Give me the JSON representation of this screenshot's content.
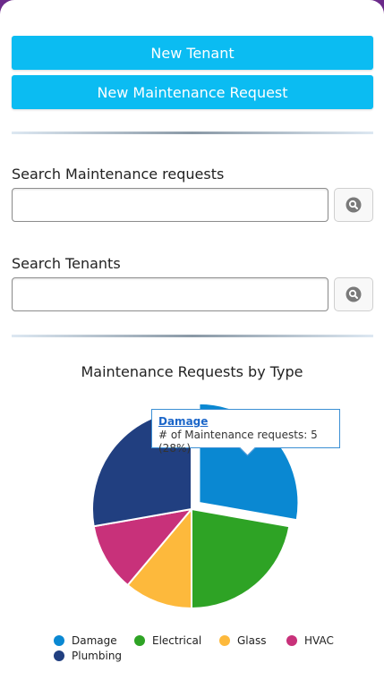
{
  "buttons": {
    "new_tenant": "New Tenant",
    "new_maintenance_request": "New Maintenance Request"
  },
  "search_maintenance": {
    "label": "Search Maintenance requests",
    "value": "",
    "button_icon": "search-icon"
  },
  "search_tenants": {
    "label": "Search Tenants",
    "value": "",
    "button_icon": "search-icon"
  },
  "tooltip": {
    "title": "Damage",
    "text": "# of Maintenance requests: 5 (28%)"
  },
  "colors": {
    "button": "#0bbcf2",
    "Damage": "#0a88d2",
    "Electrical": "#2ea325",
    "Glass": "#fdb93c",
    "HVAC": "#c8317a",
    "Plumbing": "#213f80"
  },
  "chart_data": {
    "type": "pie",
    "title": "Maintenance Requests by Type",
    "legend_position": "bottom",
    "highlighted": "Damage",
    "slices": [
      {
        "name": "Damage",
        "value": 5
      },
      {
        "name": "Electrical",
        "value": 4
      },
      {
        "name": "Glass",
        "value": 2
      },
      {
        "name": "HVAC",
        "value": 2
      },
      {
        "name": "Plumbing",
        "value": 5
      }
    ]
  }
}
